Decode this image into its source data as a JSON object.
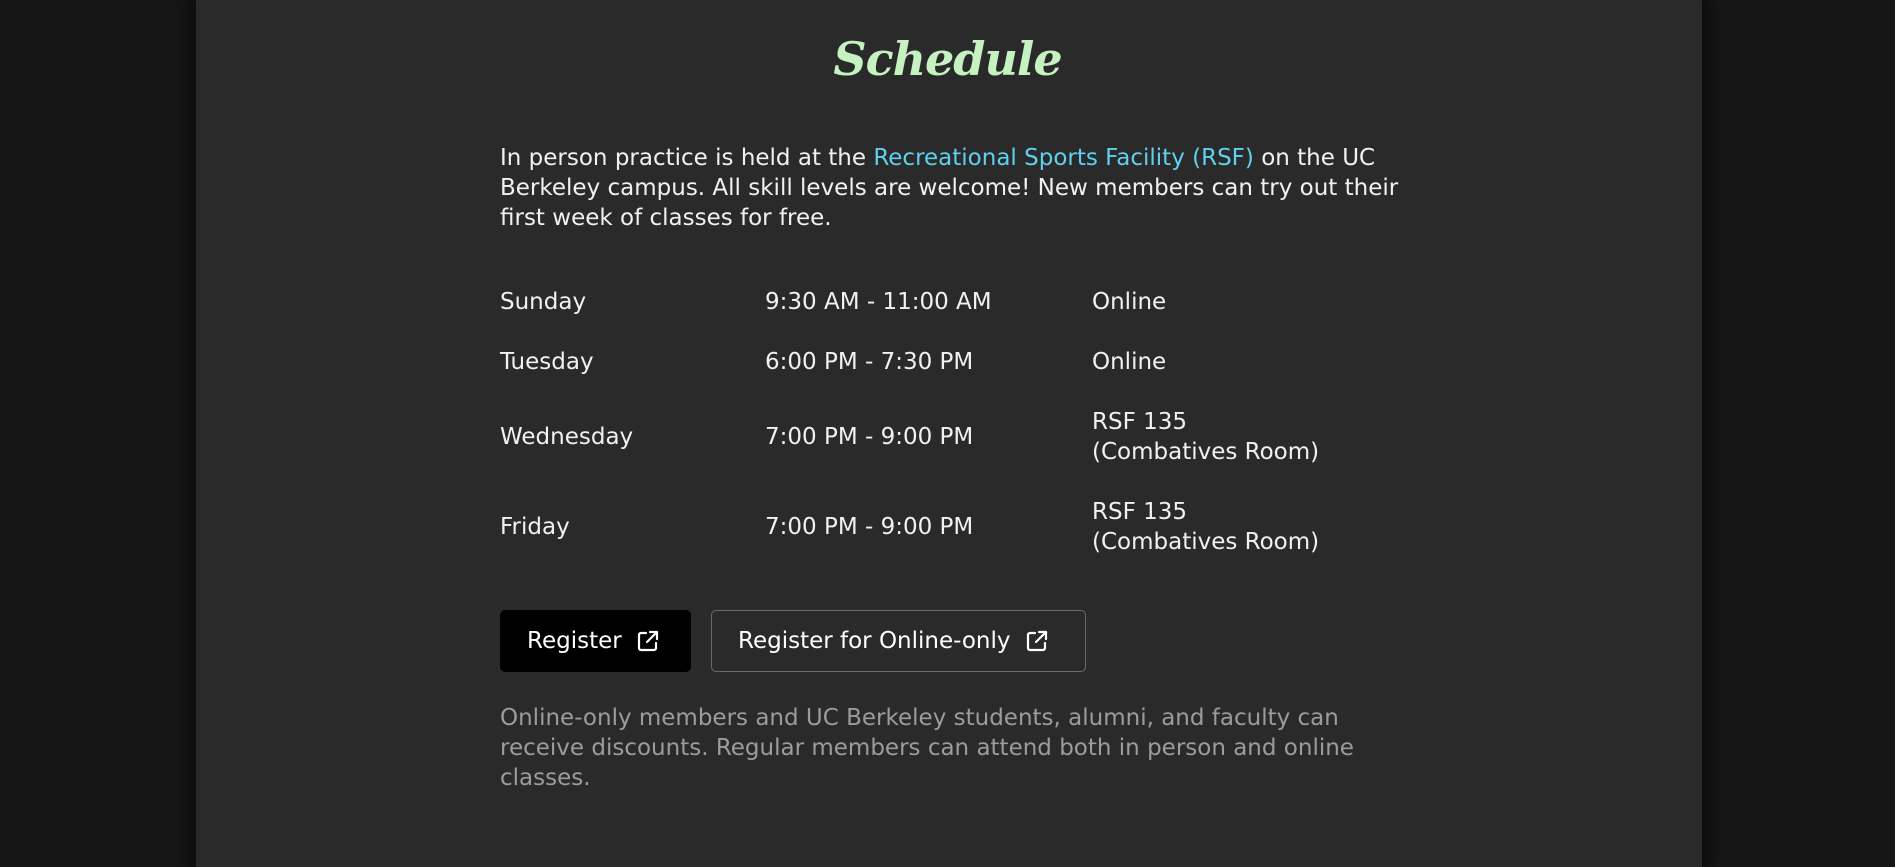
{
  "section": {
    "title": "Schedule"
  },
  "intro": {
    "before_link": "In person practice is held at the ",
    "link_text": "Recreational Sports Facility (RSF)",
    "after_link": " on the UC Berkeley campus. All skill levels are welcome! New members can try out their first week of classes for free."
  },
  "schedule": [
    {
      "day": "Sunday",
      "time": "9:30 AM - 11:00 AM",
      "location_line1": "Online",
      "location_line2": ""
    },
    {
      "day": "Tuesday",
      "time": "6:00 PM - 7:30 PM",
      "location_line1": "Online",
      "location_line2": ""
    },
    {
      "day": "Wednesday",
      "time": "7:00 PM - 9:00 PM",
      "location_line1": "RSF 135",
      "location_line2": "(Combatives Room)"
    },
    {
      "day": "Friday",
      "time": "7:00 PM - 9:00 PM",
      "location_line1": "RSF 135",
      "location_line2": "(Combatives Room)"
    }
  ],
  "buttons": {
    "register_label": "Register",
    "online_label": "Register for Online-only",
    "icon": "external-link-icon"
  },
  "note": "Online-only members and UC Berkeley students, alumni, and faculty can receive discounts. Regular members can attend both in person and online classes.",
  "colors": {
    "background": "#161616",
    "panel": "#2a2a2a",
    "title": "#c6f2c2",
    "link": "#5fd0f0",
    "text": "#f1f1f1",
    "muted": "#9c9c9c",
    "button_primary": "#000000"
  }
}
